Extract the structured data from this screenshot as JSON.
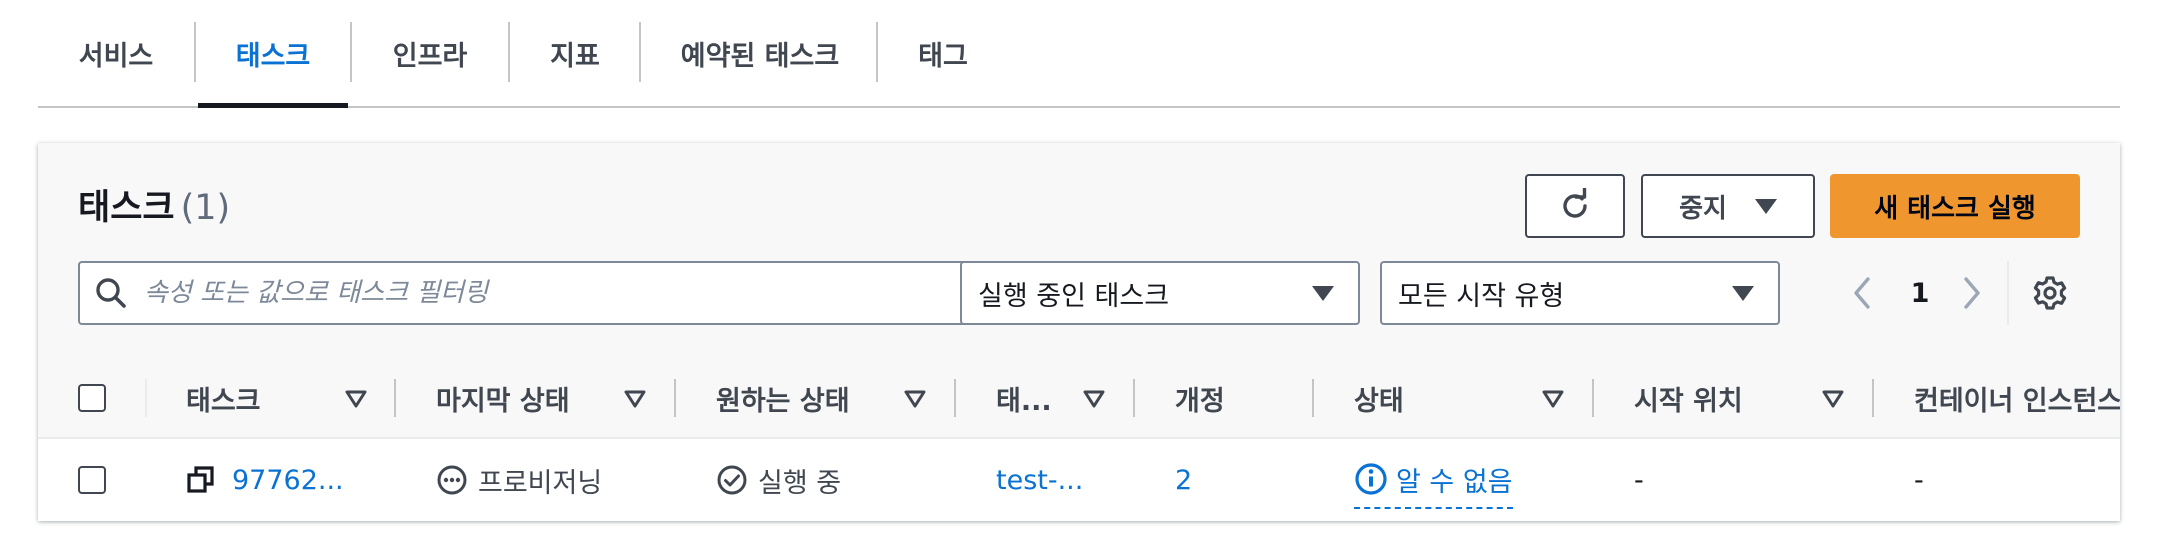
{
  "tabs": [
    {
      "label": "서비스",
      "active": false
    },
    {
      "label": "태스크",
      "active": true
    },
    {
      "label": "인프라",
      "active": false
    },
    {
      "label": "지표",
      "active": false
    },
    {
      "label": "예약된 태스크",
      "active": false
    },
    {
      "label": "태그",
      "active": false
    }
  ],
  "panel": {
    "title": "태스크",
    "count": "(1)",
    "stop_button": "중지",
    "new_task_button": "새 태스크 실행",
    "refresh_icon": "refresh-icon",
    "search": {
      "placeholder": "속성 또는 값으로 태스크 필터링",
      "value": ""
    },
    "status_filter": "실행 중인 태스크",
    "launch_type_filter": "모든 시작 유형",
    "page": "1"
  },
  "table": {
    "columns": [
      "태스크",
      "마지막 상태",
      "원하는 상태",
      "태...",
      "개정",
      "상태",
      "시작 위치",
      "컨테이너 인스턴스"
    ],
    "rows": [
      {
        "task": "97762...",
        "last_status": "프로비저닝",
        "desired_status": "실행 중",
        "task_definition": "test-...",
        "revision": "2",
        "health": "알 수 없음",
        "started_by": "-",
        "container_instance": "-"
      }
    ]
  },
  "colors": {
    "accent": "#0972d3",
    "primary_button": "#f0962f",
    "text": "#16191f",
    "muted": "#414750"
  }
}
